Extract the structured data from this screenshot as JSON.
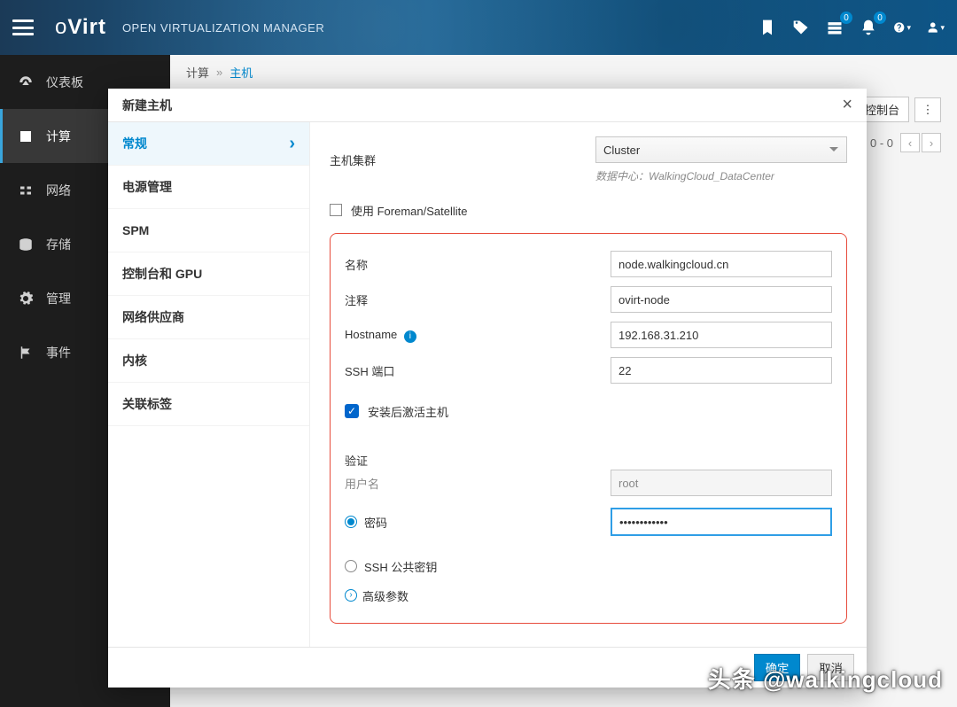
{
  "topbar": {
    "brand_prefix": "o",
    "brand_main": "Virt",
    "subtitle": "OPEN VIRTUALIZATION MANAGER",
    "badge_tasks": "0",
    "badge_alerts": "0"
  },
  "sidebar": {
    "items": [
      {
        "label": "仪表板"
      },
      {
        "label": "计算"
      },
      {
        "label": "网络"
      },
      {
        "label": "存储"
      },
      {
        "label": "管理"
      },
      {
        "label": "事件"
      }
    ]
  },
  "crumbs": {
    "a": "计算",
    "b": "主机"
  },
  "toolbar": {
    "host_console": "主机控制台",
    "range": "0 - 0"
  },
  "modal": {
    "title": "新建主机",
    "tabs": {
      "general": "常规",
      "power": "电源管理",
      "spm": "SPM",
      "console_gpu": "控制台和 GPU",
      "net_prov": "网络供应商",
      "kernel": "内核",
      "tags": "关联标签"
    },
    "form": {
      "host_cluster_label": "主机集群",
      "host_cluster_value": "Cluster",
      "dc_prefix": "数据中心：",
      "dc_value": "WalkingCloud_DataCenter",
      "foreman_label": "使用 Foreman/Satellite",
      "name_label": "名称",
      "name_value": "node.walkingcloud.cn",
      "comment_label": "注释",
      "comment_value": "ovirt-node",
      "hostname_label": "Hostname",
      "hostname_value": "192.168.31.210",
      "ssh_port_label": "SSH 端口",
      "ssh_port_value": "22",
      "activate_label": "安装后激活主机",
      "auth_header": "验证",
      "username_label": "用户名",
      "username_value": "root",
      "password_radio": "密码",
      "password_value": "••••••••••••",
      "ssh_key_radio": "SSH 公共密钥",
      "advanced": "高级参数"
    },
    "ok": "确定",
    "cancel": "取消"
  },
  "watermark": "头条 @walkingcloud"
}
